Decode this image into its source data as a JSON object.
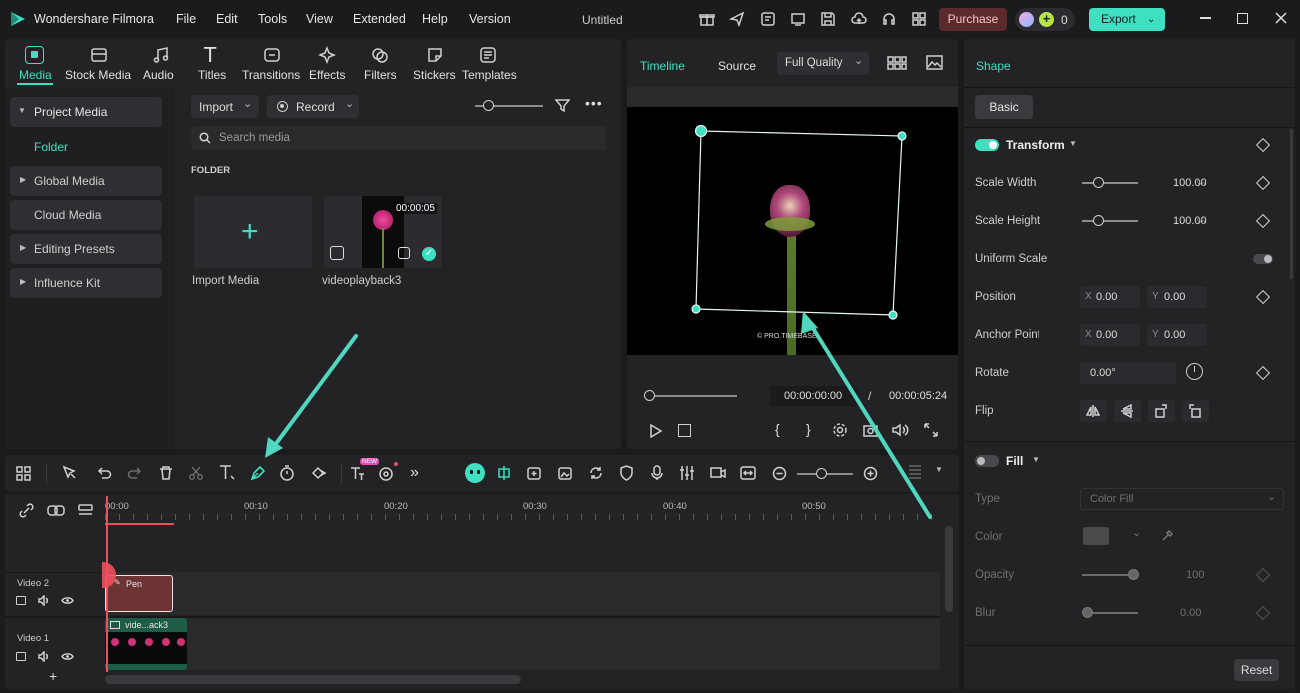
{
  "app": {
    "name": "Wondershare Filmora",
    "doc_title": "Untitled"
  },
  "menu": [
    "File",
    "Edit",
    "Tools",
    "View",
    "Extended",
    "Help",
    "Version"
  ],
  "header": {
    "purchase": "Purchase",
    "credits": "0",
    "export": "Export"
  },
  "toolbar_tabs": [
    "Media",
    "Stock Media",
    "Audio",
    "Titles",
    "Transitions",
    "Effects",
    "Filters",
    "Stickers",
    "Templates"
  ],
  "sidebar": {
    "project_media": "Project Media",
    "folder": "Folder",
    "global_media": "Global Media",
    "cloud_media": "Cloud Media",
    "editing_presets": "Editing Presets",
    "influence_kit": "Influence Kit"
  },
  "media": {
    "import": "Import",
    "record": "Record",
    "search_placeholder": "Search media",
    "folder_heading": "FOLDER",
    "import_tile_label": "Import Media",
    "clip_name": "videoplayback3",
    "clip_duration": "00:00:05"
  },
  "preview": {
    "tab_timeline": "Timeline",
    "tab_source": "Source",
    "quality": "Full Quality",
    "watermark": "© PRO.TIMEBASE",
    "current_time": "00:00:00:00",
    "separator": "/",
    "total_time": "00:00:05:24",
    "bracket_in": "{",
    "bracket_out": "}"
  },
  "props": {
    "tab": "Shape",
    "subtab": "Basic",
    "transform": "Transform",
    "scale_width": {
      "label": "Scale Width",
      "value": "100.00",
      "unit": "%"
    },
    "scale_height": {
      "label": "Scale Height",
      "value": "100.00",
      "unit": "%"
    },
    "uniform_scale": "Uniform Scale",
    "position": {
      "label": "Position",
      "x": "0.00",
      "y": "0.00"
    },
    "anchor": {
      "label": "Anchor Point",
      "x": "0.00",
      "y": "0.00"
    },
    "rotate": {
      "label": "Rotate",
      "value": "0.00°"
    },
    "flip": "Flip",
    "fill": "Fill",
    "type": {
      "label": "Type",
      "value": "Color Fill"
    },
    "color": "Color",
    "opacity": {
      "label": "Opacity",
      "value": "100"
    },
    "blur": {
      "label": "Blur",
      "value": "0.00"
    },
    "reset": "Reset",
    "x_label": "X",
    "y_label": "Y"
  },
  "timeline": {
    "ticks": [
      "00:00",
      "00:10",
      "00:20",
      "00:30",
      "00:40",
      "00:50"
    ],
    "track2": "Video 2",
    "track1": "Video 1",
    "pen_clip": "Pen",
    "video_clip": "vide...ack3",
    "new_badge": "NEW"
  },
  "colors": {
    "accent": "#3ee0c1",
    "purchase": "#5a2a2d",
    "playhead": "#ef4f5c",
    "pen_clip": "#6e3434"
  }
}
